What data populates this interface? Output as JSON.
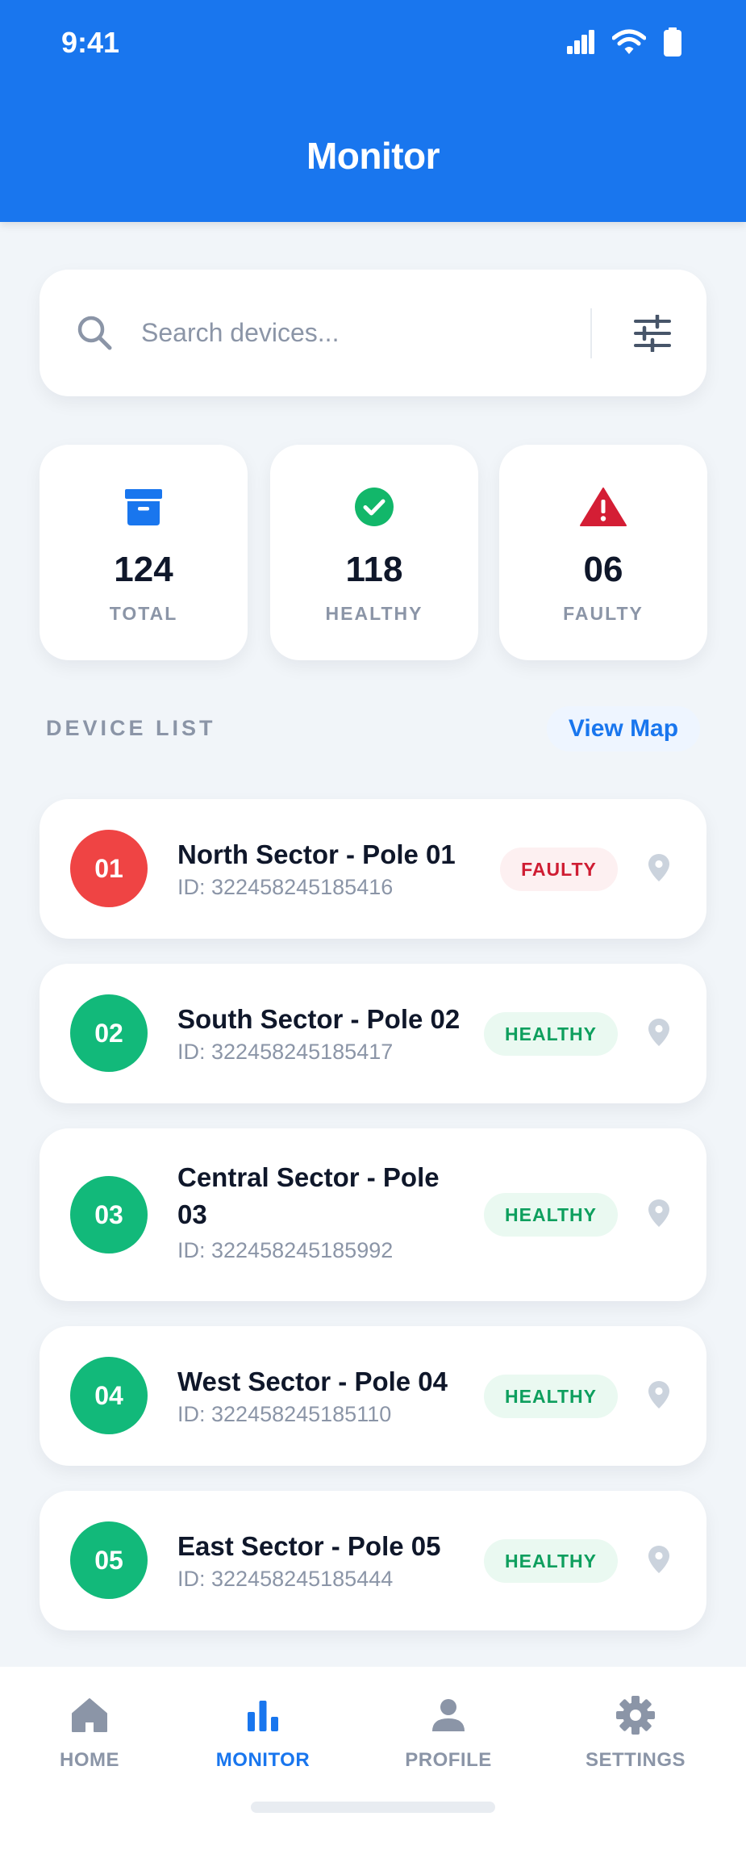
{
  "status_bar": {
    "time": "9:41"
  },
  "header": {
    "title": "Monitor"
  },
  "search": {
    "placeholder": "Search devices...",
    "value": ""
  },
  "stats": [
    {
      "icon": "archive-box-icon",
      "value": "124",
      "label": "TOTAL",
      "color": "#1976ee"
    },
    {
      "icon": "check-circle-icon",
      "value": "118",
      "label": "HEALTHY",
      "color": "#12b76a"
    },
    {
      "icon": "warning-triangle-icon",
      "value": "06",
      "label": "FAULTY",
      "color": "#d41e35"
    }
  ],
  "device_list": {
    "title": "DEVICE LIST",
    "view_map_label": "View Map",
    "items": [
      {
        "number": "01",
        "name": "North Sector - Pole 01",
        "id": "ID: 322458245185416",
        "status": "FAULTY",
        "color": "#ef4444"
      },
      {
        "number": "02",
        "name": "South Sector - Pole 02",
        "id": "ID: 322458245185417",
        "status": "HEALTHY",
        "color": "#12b97a"
      },
      {
        "number": "03",
        "name": "Central Sector - Pole 03",
        "id": "ID: 322458245185992",
        "status": "HEALTHY",
        "color": "#12b97a"
      },
      {
        "number": "04",
        "name": "West Sector - Pole 04",
        "id": "ID: 322458245185110",
        "status": "HEALTHY",
        "color": "#12b97a"
      },
      {
        "number": "05",
        "name": "East Sector - Pole 05",
        "id": "ID: 322458245185444",
        "status": "HEALTHY",
        "color": "#12b97a"
      }
    ]
  },
  "bottom_nav": {
    "items": [
      {
        "label": "HOME",
        "icon": "home-icon",
        "active": false
      },
      {
        "label": "MONITOR",
        "icon": "bar-chart-icon",
        "active": true
      },
      {
        "label": "PROFILE",
        "icon": "person-icon",
        "active": false
      },
      {
        "label": "SETTINGS",
        "icon": "gear-icon",
        "active": false
      }
    ]
  },
  "colors": {
    "primary": "#1976ee",
    "healthy": "#12b97a",
    "faulty": "#ef4444",
    "muted": "#8b95a7",
    "background": "#f1f5f9"
  }
}
